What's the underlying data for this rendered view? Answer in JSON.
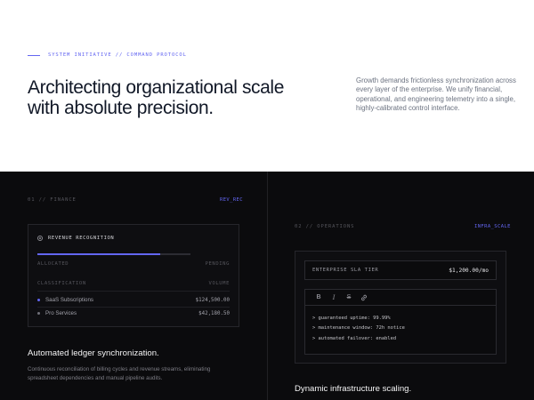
{
  "hero": {
    "eyebrow": "SYSTEM INITIATIVE // COMMAND PROTOCOL",
    "headline_line1": "Architecting organizational scale",
    "headline_line2": "with absolute precision.",
    "description": "Growth demands frictionless synchronization across every layer of the enterprise. We unify financial, operational, and engineering telemetry into a single, highly-calibrated control interface."
  },
  "finance": {
    "label": "01 // FINANCE",
    "code": "REV_REC",
    "card": {
      "title": "REVENUE RECOGNITION",
      "progress": 0.8,
      "status_left": "ALLOCATED",
      "status_right": "PENDING",
      "col_left": "CLASSIFICATION",
      "col_right": "VOLUME",
      "rows": [
        {
          "label": "SaaS Subscriptions",
          "value": "$124,500.00",
          "color": "#6366f1"
        },
        {
          "label": "Pro Services",
          "value": "$42,180.50",
          "color": "#71717a"
        }
      ]
    },
    "title": "Automated ledger synchronization.",
    "description": "Continuous reconciliation of billing cycles and revenue streams, eliminating spreadsheet dependencies and manual pipeline audits."
  },
  "operations": {
    "label": "02 // OPERATIONS",
    "code": "INFRA_SCALE",
    "tier_label": "ENTERPRISE SLA TIER",
    "tier_price": "$1,200.00/mo",
    "toolbar": {
      "bold": "B",
      "italic": "I",
      "strike": "S"
    },
    "lines": [
      "> guaranteed uptime: 99.99%",
      "> maintenance window: 72h notice",
      "> automated failover: enabled"
    ],
    "title": "Dynamic infrastructure scaling."
  },
  "colors": {
    "accent": "#6366f1",
    "dark_bg": "#0b0b0d",
    "light_bg": "#ffffff"
  }
}
